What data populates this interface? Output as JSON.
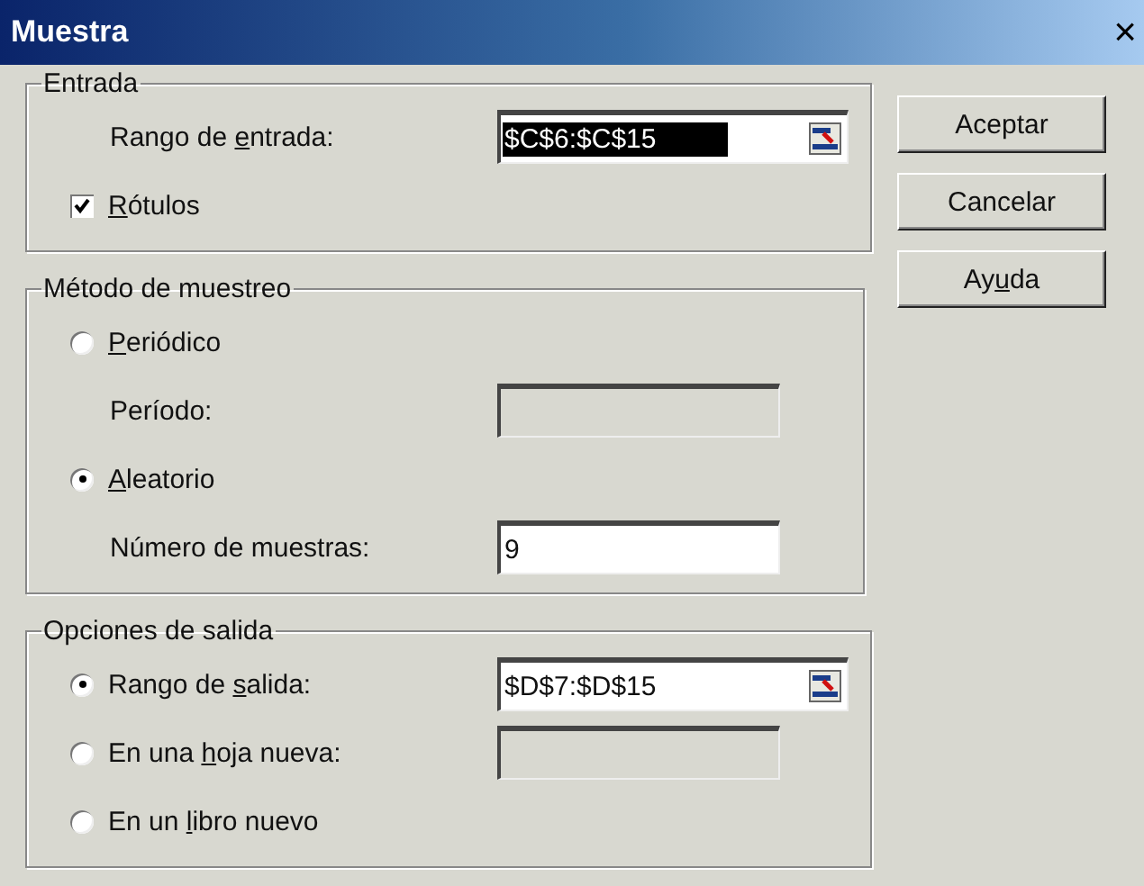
{
  "window": {
    "title": "Muestra",
    "close": "×"
  },
  "groups": [
    {
      "title": "Entrada",
      "rows": [
        {
          "kind": "field",
          "label": {
            "before": "Rango de ",
            "key": "e",
            "after": "ntrada:"
          },
          "value": "$C$6:$C$15",
          "highlighted": true,
          "disabled": false,
          "picker": true
        },
        {
          "kind": "checkbox",
          "label": {
            "key": "R",
            "after": "ótulos"
          },
          "checked": true
        }
      ]
    },
    {
      "title": "Método de muestreo",
      "rows": [
        {
          "kind": "radio",
          "label": {
            "key": "P",
            "after": "eriódico"
          },
          "selected": false
        },
        {
          "kind": "field",
          "label": {
            "before": "Período:"
          },
          "highlighted": false,
          "disabled": true,
          "picker": false
        },
        {
          "kind": "radio",
          "label": {
            "key": "A",
            "after": "leatorio"
          },
          "selected": true
        },
        {
          "kind": "field",
          "label": {
            "before": "Número de muestras:"
          },
          "value": "9",
          "highlighted": false,
          "disabled": false,
          "picker": false
        }
      ]
    },
    {
      "title": "Opciones de salida",
      "rows": [
        {
          "kind": "radio-field",
          "label": {
            "before": "Rango de ",
            "key": "s",
            "after": "alida:"
          },
          "selected": true,
          "value": "$D$7:$D$15",
          "highlighted": false,
          "disabled": false,
          "picker": true
        },
        {
          "kind": "radio-field",
          "label": {
            "before": "En una ",
            "key": "h",
            "after": "oja nueva:"
          },
          "selected": false,
          "highlighted": false,
          "disabled": true,
          "picker": false
        },
        {
          "kind": "radio",
          "label": {
            "before": "En un ",
            "key": "l",
            "after": "ibro nuevo"
          },
          "selected": false
        }
      ]
    }
  ],
  "buttons": [
    {
      "label": {
        "before": "Aceptar"
      }
    },
    {
      "label": {
        "before": "Cancelar"
      }
    },
    {
      "label": {
        "before": "Ay",
        "key": "u",
        "after": "da"
      }
    }
  ]
}
